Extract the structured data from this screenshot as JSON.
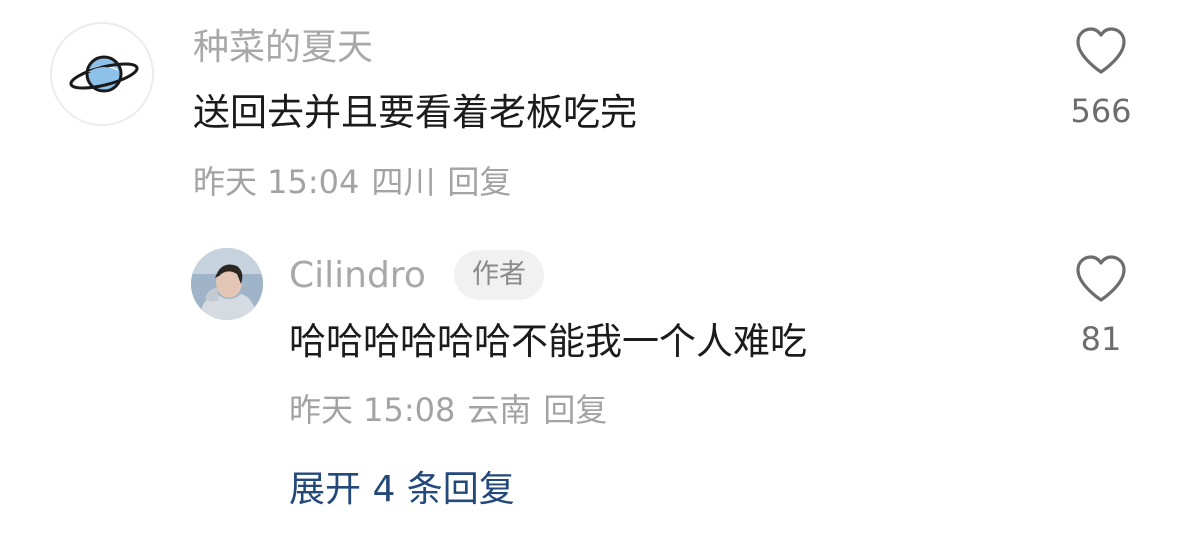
{
  "comment": {
    "username": "种菜的夏天",
    "text": "送回去并且要看着老板吃完",
    "time": "昨天 15:04",
    "location": "四川",
    "reply_label": "回复",
    "likes": "566",
    "avatar_icon": "planet-icon"
  },
  "reply": {
    "username": "Cilindro",
    "author_badge": "作者",
    "text": "哈哈哈哈哈哈不能我一个人难吃",
    "time": "昨天 15:08",
    "location": "云南",
    "reply_label": "回复",
    "likes": "81",
    "avatar_icon": "user-photo"
  },
  "expand_replies": "展开 4 条回复",
  "colors": {
    "username": "#a8a8a8",
    "comment_text": "#1b1b1b",
    "meta": "#a3a3a3",
    "expand_link": "#23487a",
    "like_icon": "#6d6d6d"
  }
}
